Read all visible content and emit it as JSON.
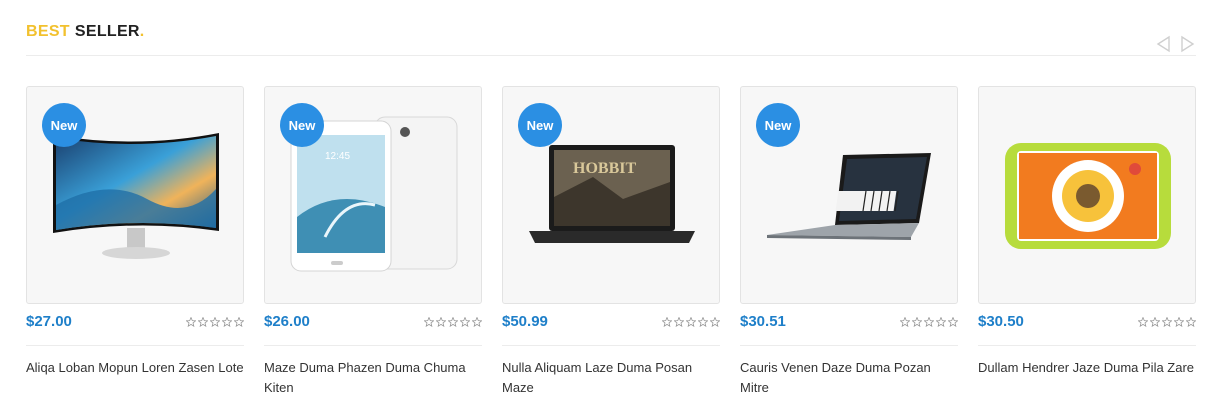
{
  "section": {
    "title_highlight": "BEST",
    "title_rest": "SELLER",
    "title_dot": "."
  },
  "nav": {
    "prev_icon": "chevron-left-icon",
    "next_icon": "chevron-right-icon"
  },
  "colors": {
    "accent": "#f2c12e",
    "badge": "#2b8fe3",
    "price": "#1e7fc9"
  },
  "products": [
    {
      "badge": "New",
      "price": "$27.00",
      "name": "Aliqa Loban Mopun Loren Zasen Lote",
      "rating": 0,
      "image": "curved-monitor"
    },
    {
      "badge": "New",
      "price": "$26.00",
      "name": "Maze Duma Phazen Duma Chuma Kiten",
      "rating": 0,
      "image": "tablet"
    },
    {
      "badge": "New",
      "price": "$50.99",
      "name": "Nulla Aliquam Laze Duma Posan Maze",
      "rating": 0,
      "image": "laptop"
    },
    {
      "badge": "New",
      "price": "$30.51",
      "name": "Cauris Venen Daze Duma Pozan Mitre",
      "rating": 0,
      "image": "laptop-piano"
    },
    {
      "badge": "",
      "price": "$30.50",
      "name": "Dullam Hendrer Jaze Duma Pila Zare",
      "rating": 0,
      "image": "kids-tablet"
    }
  ]
}
